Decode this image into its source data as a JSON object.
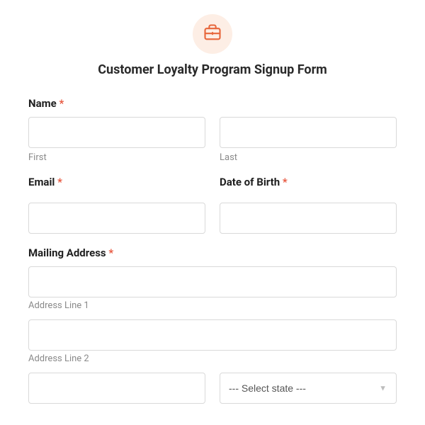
{
  "header": {
    "icon": "briefcase-icon",
    "title": "Customer Loyalty Program Signup Form"
  },
  "required_mark": "*",
  "name": {
    "label": "Name",
    "first_sub": "First",
    "last_sub": "Last"
  },
  "email": {
    "label": "Email"
  },
  "dob": {
    "label": "Date of Birth"
  },
  "address": {
    "label": "Mailing Address",
    "line1_sub": "Address Line 1",
    "line2_sub": "Address Line 2",
    "state_placeholder": "--- Select state ---"
  }
}
